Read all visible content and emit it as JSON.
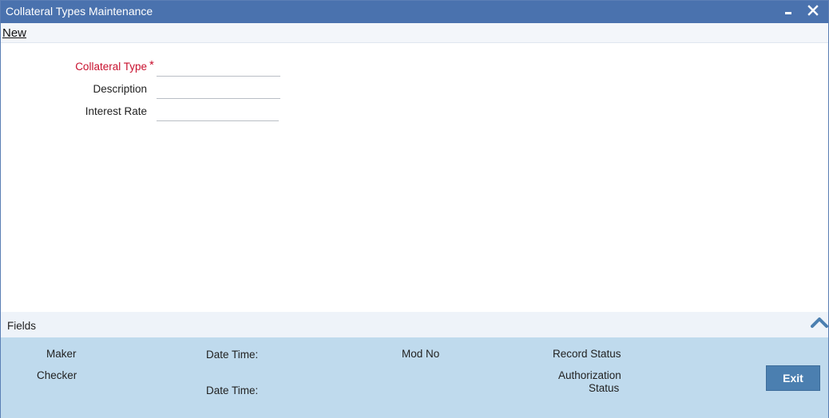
{
  "window": {
    "title": "Collateral Types Maintenance"
  },
  "menubar": {
    "new_label": "New"
  },
  "form": {
    "collateral_type": {
      "label": "Collateral Type",
      "required_marker": "*",
      "value": ""
    },
    "description": {
      "label": "Description",
      "value": ""
    },
    "interest_rate": {
      "label": "Interest Rate",
      "value": ""
    }
  },
  "fields_bar": {
    "label": "Fields"
  },
  "audit": {
    "maker": "Maker",
    "checker": "Checker",
    "date_time_1": "Date Time:",
    "date_time_2": "Date Time:",
    "mod_no": "Mod No",
    "record_status": "Record Status",
    "authorization_status_1": "Authorization",
    "authorization_status_2": "Status"
  },
  "actions": {
    "exit_label": "Exit"
  },
  "colors": {
    "titlebar": "#4a72ae",
    "required": "#c8102e",
    "audit_panel": "#bfdaed",
    "exit_button": "#4b7fb0"
  },
  "icons": {
    "minimize": "minimize-icon",
    "close": "close-icon",
    "collapse": "chevron-up-icon"
  }
}
